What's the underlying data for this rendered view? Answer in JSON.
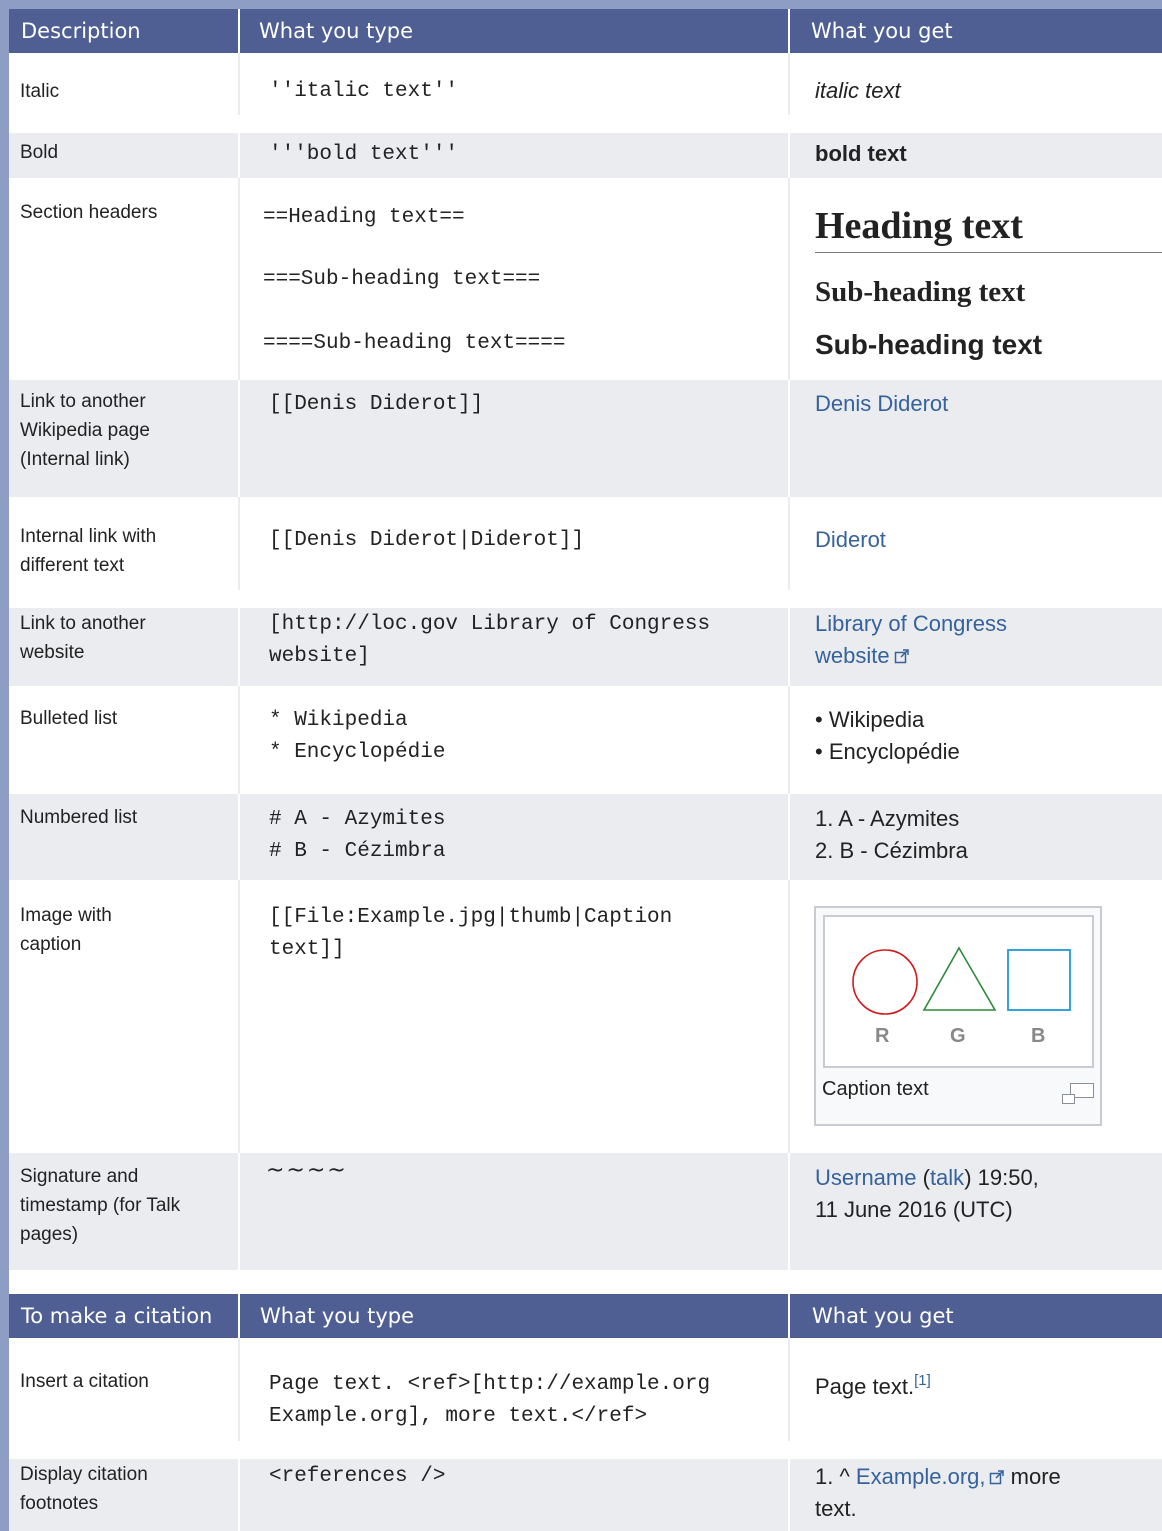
{
  "table1": {
    "headers": [
      "Description",
      "What you type",
      "What you get"
    ],
    "italic": {
      "desc": "Italic",
      "type": "''italic text''",
      "get": "italic text"
    },
    "bold": {
      "desc": "Bold",
      "type": "'''bold text'''",
      "get": "bold text"
    },
    "headers_row": {
      "desc": "Section headers",
      "type": [
        "==Heading text==",
        "===Sub-heading text===",
        "====Sub-heading text===="
      ],
      "get": [
        "Heading text",
        "Sub-heading text",
        "Sub-heading text"
      ]
    },
    "internal_link": {
      "desc": [
        "Link to another",
        "Wikipedia page",
        "(Internal link)"
      ],
      "type": "[[Denis Diderot]]",
      "get": "Denis Diderot"
    },
    "piped_link": {
      "desc": [
        "Internal link with",
        "different text"
      ],
      "type": "[[Denis Diderot|Diderot]]",
      "get": "Diderot"
    },
    "external_link": {
      "desc": [
        "Link to another",
        "website"
      ],
      "type": [
        "[http://loc.gov Library of Congress",
        "website]"
      ],
      "get": [
        "Library of Congress",
        "website"
      ]
    },
    "bulleted": {
      "desc": "Bulleted list",
      "type": [
        "* Wikipedia",
        "* Encyclopédie"
      ],
      "get": [
        "Wikipedia",
        "Encyclopédie"
      ],
      "bullet": "•"
    },
    "numbered": {
      "desc": "Numbered list",
      "type": [
        "# A - Azymites",
        "# B - Cézimbra"
      ],
      "get": [
        "1. A - Azymites",
        "2. B - Cézimbra"
      ]
    },
    "image": {
      "desc": [
        "Image with",
        "caption"
      ],
      "type": [
        "[[File:Example.jpg|thumb|Caption",
        "text]]"
      ],
      "shape_labels": [
        "R",
        "G",
        "B"
      ],
      "caption": "Caption text",
      "colors": {
        "red": "#d01a1e",
        "green": "#2e8b3a",
        "blue": "#1d9ad6"
      }
    },
    "signature": {
      "desc": [
        "Signature and",
        "timestamp (for Talk",
        "pages)"
      ],
      "type": "~~~~",
      "user": "Username",
      "open_paren": "(",
      "talk": "talk",
      "close_paren": ")",
      "time": " 19:50,",
      "date": "11 June 2016 (UTC)"
    }
  },
  "table2": {
    "headers": [
      "To make a citation",
      "What you type",
      "What you get"
    ],
    "insert": {
      "desc": "Insert a citation",
      "type": [
        "Page text. <ref>[http://example.org",
        "Example.org], more text.</ref>"
      ],
      "get": "Page text.",
      "sup": "[1]"
    },
    "display": {
      "desc": [
        "Display citation",
        "footnotes"
      ],
      "type": "<references />",
      "num": "1. ^ ",
      "link": "Example.org,",
      "rest": " more",
      "rest2": "text."
    }
  },
  "colors": {
    "header_bg": "#4f5f93",
    "alt_row": "#eaecf0",
    "link": "#36629c",
    "frame": "#8d9dc4"
  }
}
